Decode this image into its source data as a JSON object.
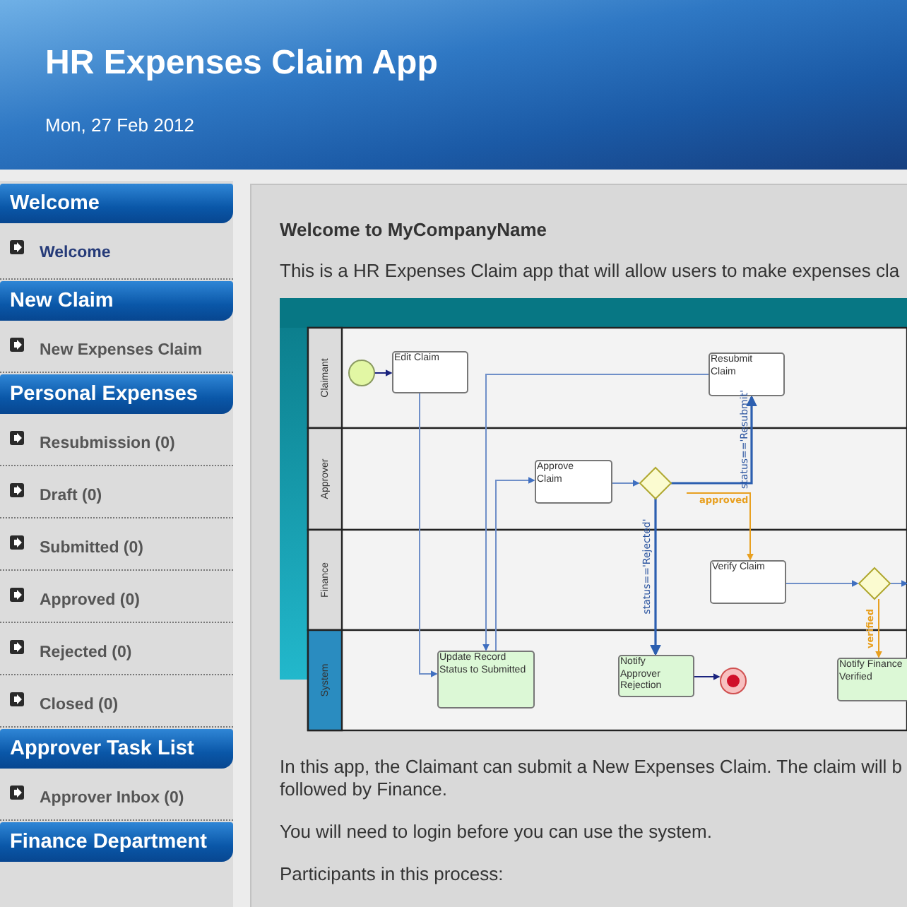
{
  "header": {
    "title": "HR Expenses Claim App",
    "date": "Mon, 27 Feb 2012"
  },
  "sidebar": {
    "sections": [
      {
        "title": "Welcome",
        "items": [
          {
            "label": "Welcome",
            "selected": true
          }
        ]
      },
      {
        "title": "New Claim",
        "items": [
          {
            "label": "New Expenses Claim",
            "selected": false
          }
        ]
      },
      {
        "title": "Personal Expenses",
        "items": [
          {
            "label": "Resubmission (0)",
            "selected": false
          },
          {
            "label": "Draft (0)",
            "selected": false
          },
          {
            "label": "Submitted (0)",
            "selected": false
          },
          {
            "label": "Approved (0)",
            "selected": false
          },
          {
            "label": "Rejected (0)",
            "selected": false
          },
          {
            "label": "Closed (0)",
            "selected": false
          }
        ]
      },
      {
        "title": "Approver Task List",
        "items": [
          {
            "label": "Approver Inbox (0)",
            "selected": false
          }
        ]
      },
      {
        "title": "Finance Department"
      }
    ]
  },
  "content": {
    "heading": "Welcome to MyCompanyName",
    "intro": "This is a HR Expenses Claim app that will allow users to make expenses cla",
    "diagram": {
      "lanes": [
        {
          "label": "Claimant",
          "kind": "user"
        },
        {
          "label": "Approver",
          "kind": "user"
        },
        {
          "label": "Finance",
          "kind": "user"
        },
        {
          "label": "System",
          "kind": "system"
        }
      ],
      "tasks": [
        {
          "label": "Edit Claim",
          "kind": "user"
        },
        {
          "label": "Resubmit Claim",
          "kind": "user"
        },
        {
          "label": "Approve Claim",
          "kind": "user"
        },
        {
          "label": "Verify Claim",
          "kind": "user"
        },
        {
          "label": "Update Record Status to Submitted",
          "kind": "system"
        },
        {
          "label": "Notify Approver Rejection",
          "kind": "system"
        },
        {
          "label": "Notify Finance Verified",
          "kind": "system"
        }
      ],
      "condition_labels": [
        {
          "label": "status=='Resubmit'",
          "kind": "default"
        },
        {
          "label": "approved",
          "kind": "highlight"
        },
        {
          "label": "status=='Rejected'",
          "kind": "default"
        },
        {
          "label": "verified",
          "kind": "highlight"
        }
      ]
    },
    "paragraphs": [
      "In this app, the Claimant can submit a New Expenses Claim. The claim will b\nfollowed by Finance.",
      "You will need to login before you can use the system.",
      "Participants in this process:"
    ]
  }
}
